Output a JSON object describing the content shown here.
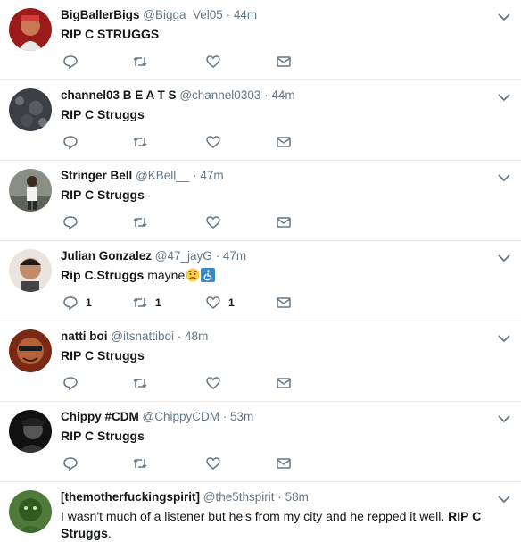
{
  "tweets": [
    {
      "name": "BigBallerBigs",
      "handle": "@Bigga_Vel05",
      "time": "44m",
      "text": "RIP C STRUGGS",
      "reply_count": "",
      "retweet_count": "",
      "like_count": ""
    },
    {
      "name": "channel03 B E A T S",
      "handle": "@channel0303",
      "time": "44m",
      "text": "RIP C Struggs",
      "reply_count": "",
      "retweet_count": "",
      "like_count": ""
    },
    {
      "name": "Stringer Bell",
      "handle": "@KBell__",
      "time": "47m",
      "text": "RIP C Struggs",
      "reply_count": "",
      "retweet_count": "",
      "like_count": ""
    },
    {
      "name": "Julian Gonzalez",
      "handle": "@47_jayG",
      "time": "47m",
      "text_bold": "Rip C.Struggs",
      "text_rest": " mayne",
      "emojis": [
        "worried-face-emoji",
        "wheelchair-symbol-emoji"
      ],
      "reply_count": "1",
      "retweet_count": "1",
      "like_count": "1"
    },
    {
      "name": "natti boi",
      "handle": "@itsnattiboi",
      "time": "48m",
      "text": "RIP C Struggs",
      "reply_count": "",
      "retweet_count": "",
      "like_count": ""
    },
    {
      "name": "Chippy #CDM",
      "handle": "@ChippyCDM",
      "time": "53m",
      "text": "RIP C Struggs",
      "reply_count": "",
      "retweet_count": "",
      "like_count": ""
    },
    {
      "name": "[themotherfuckingspirit]",
      "handle": "@the5thspirit",
      "time": "58m",
      "text_plain": "I wasn't much of a listener but he's from my city and he repped it well. ",
      "text_bold": "RIP C Struggs",
      "text_end": "."
    }
  ],
  "separator": "·",
  "colors": {
    "text": "#14171a",
    "secondary": "#657786",
    "divider": "#e6ecf0"
  }
}
